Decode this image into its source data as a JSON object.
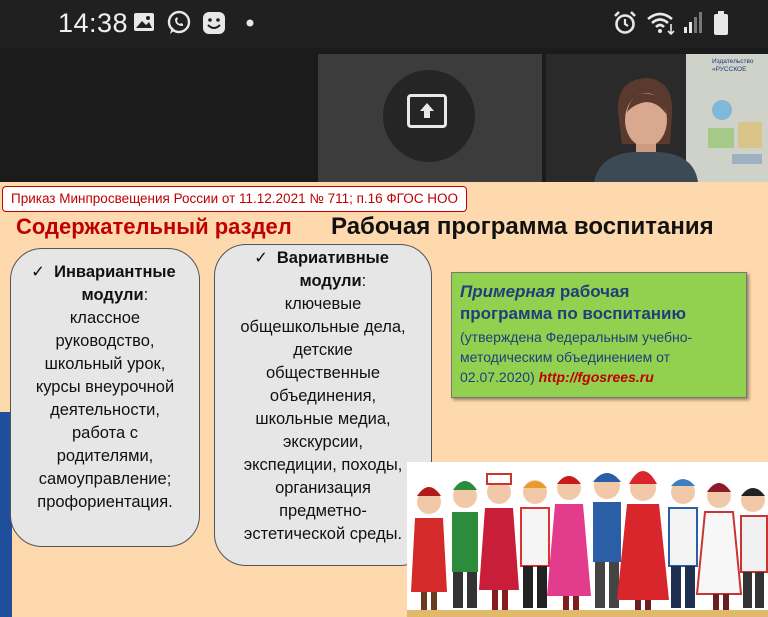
{
  "status_bar": {
    "time": "14:38",
    "icons": [
      "gallery-icon",
      "whatsapp-icon",
      "emoji-icon",
      "dot-icon",
      "alarm-icon",
      "wifi-icon",
      "signal-icon",
      "battery-icon"
    ]
  },
  "video_bar": {
    "share_tile": {
      "icon": "share-screen-icon"
    },
    "camera_tile": {
      "poster_text": "Издательство «РУССКОЕ СЛОВО»"
    }
  },
  "slide": {
    "order_text": "Приказ Минпросвещения России от 11.12.2021 № 711; п.16 ФГОС НОО",
    "section_title": "Содержательный раздел",
    "program_title": "Рабочая программа воспитания",
    "invariant": {
      "check": "✓",
      "head": "Инвариантные модули",
      "colon": ":",
      "lines": [
        "классное",
        "руководство,",
        "школьный урок,",
        "курсы внеурочной",
        "деятельности,",
        "работа с",
        "родителями,",
        "самоуправление;",
        "профориентация."
      ]
    },
    "variative": {
      "check": "✓",
      "head": "Вариативные модули",
      "colon": ":",
      "lines": [
        "ключевые",
        "общешкольные дела,",
        "детские",
        "общественные",
        "объединения,",
        "школьные медиа,",
        "экскурсии,",
        "экспедиции, походы,",
        "организация",
        "предметно-",
        "эстетической среды."
      ]
    },
    "example_program": {
      "italic_word": "Примерная",
      "rest_line1": " рабочая",
      "line2": "программа по воспитанию",
      "note1": "(утверждена Федеральным учебно-",
      "note2": "методическим объединением от",
      "note3_date": "02.07.2020)",
      "url": "http://fgosrees.ru"
    }
  },
  "colors": {
    "slide_bg": "#fdd9ad",
    "red": "#c00000",
    "green_box": "#92d050",
    "blue_text": "#1f3f7a",
    "module_box": "#e6e6e6"
  }
}
